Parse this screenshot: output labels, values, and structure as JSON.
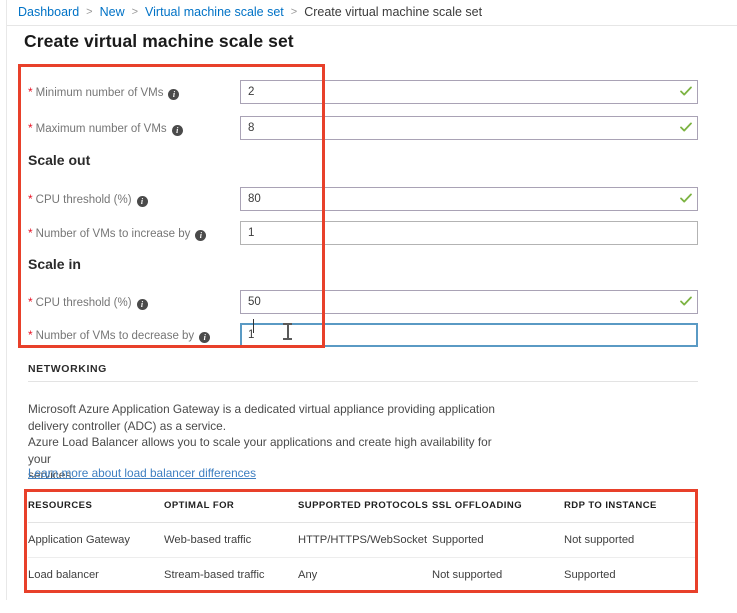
{
  "breadcrumb": {
    "items": [
      {
        "label": "Dashboard",
        "current": false
      },
      {
        "label": "New",
        "current": false
      },
      {
        "label": "Virtual machine scale set",
        "current": false
      },
      {
        "label": "Create virtual machine scale set",
        "current": true
      }
    ],
    "separator": ">"
  },
  "page": {
    "title": "Create virtual machine scale set"
  },
  "form": {
    "required_marker": "*",
    "info_glyph": "i",
    "fields": [
      {
        "label": "Minimum number of VMs",
        "value": "2",
        "state": "valid",
        "validated": true
      },
      {
        "label": "Maximum number of VMs",
        "value": "8",
        "state": "valid",
        "validated": true
      },
      {
        "label": "CPU threshold (%)",
        "value": "80",
        "state": "valid",
        "validated": true
      },
      {
        "label": "Number of VMs to increase by",
        "value": "1",
        "state": "plain",
        "validated": false
      },
      {
        "label": "CPU threshold (%)",
        "value": "50",
        "state": "valid",
        "validated": true
      },
      {
        "label": "Number of VMs to decrease by",
        "value": "1",
        "state": "focused",
        "validated": false
      }
    ],
    "section_scale_out": "Scale out",
    "section_scale_in": "Scale in"
  },
  "networking": {
    "heading": "NETWORKING",
    "description": "Microsoft Azure Application Gateway is a dedicated virtual appliance providing application delivery controller (ADC) as a service. Azure Load Balancer allows you to scale your applications and create high availability for your services.",
    "description_line1": "Microsoft Azure Application Gateway is a dedicated virtual appliance providing application",
    "description_line2": "delivery controller (ADC) as a service.",
    "description_line3": "Azure Load Balancer allows you to scale your applications and create high availability for your",
    "description_line4": "services.",
    "link_label": "Learn more about load balancer differences"
  },
  "comparison_table": {
    "columns": [
      "RESOURCES",
      "OPTIMAL FOR",
      "SUPPORTED PROTOCOLS",
      "SSL OFFLOADING",
      "RDP TO INSTANCE"
    ],
    "rows": [
      [
        "Application Gateway",
        "Web-based traffic",
        "HTTP/HTTPS/WebSocket",
        "Supported",
        "Not supported"
      ],
      [
        "Load balancer",
        "Stream-based traffic",
        "Any",
        "Not supported",
        "Supported"
      ]
    ]
  },
  "annotations": {
    "color": "#e8402a",
    "boxes": [
      {
        "name": "autoscale-fields-highlight"
      },
      {
        "name": "comparison-table-highlight"
      }
    ]
  },
  "colors": {
    "link": "#0072c6",
    "required": "#e81123",
    "input_border": "#a9a2b5",
    "input_border_focused": "#5a9ac4",
    "valid_check": "#7cb342",
    "annotation": "#e8402a"
  }
}
